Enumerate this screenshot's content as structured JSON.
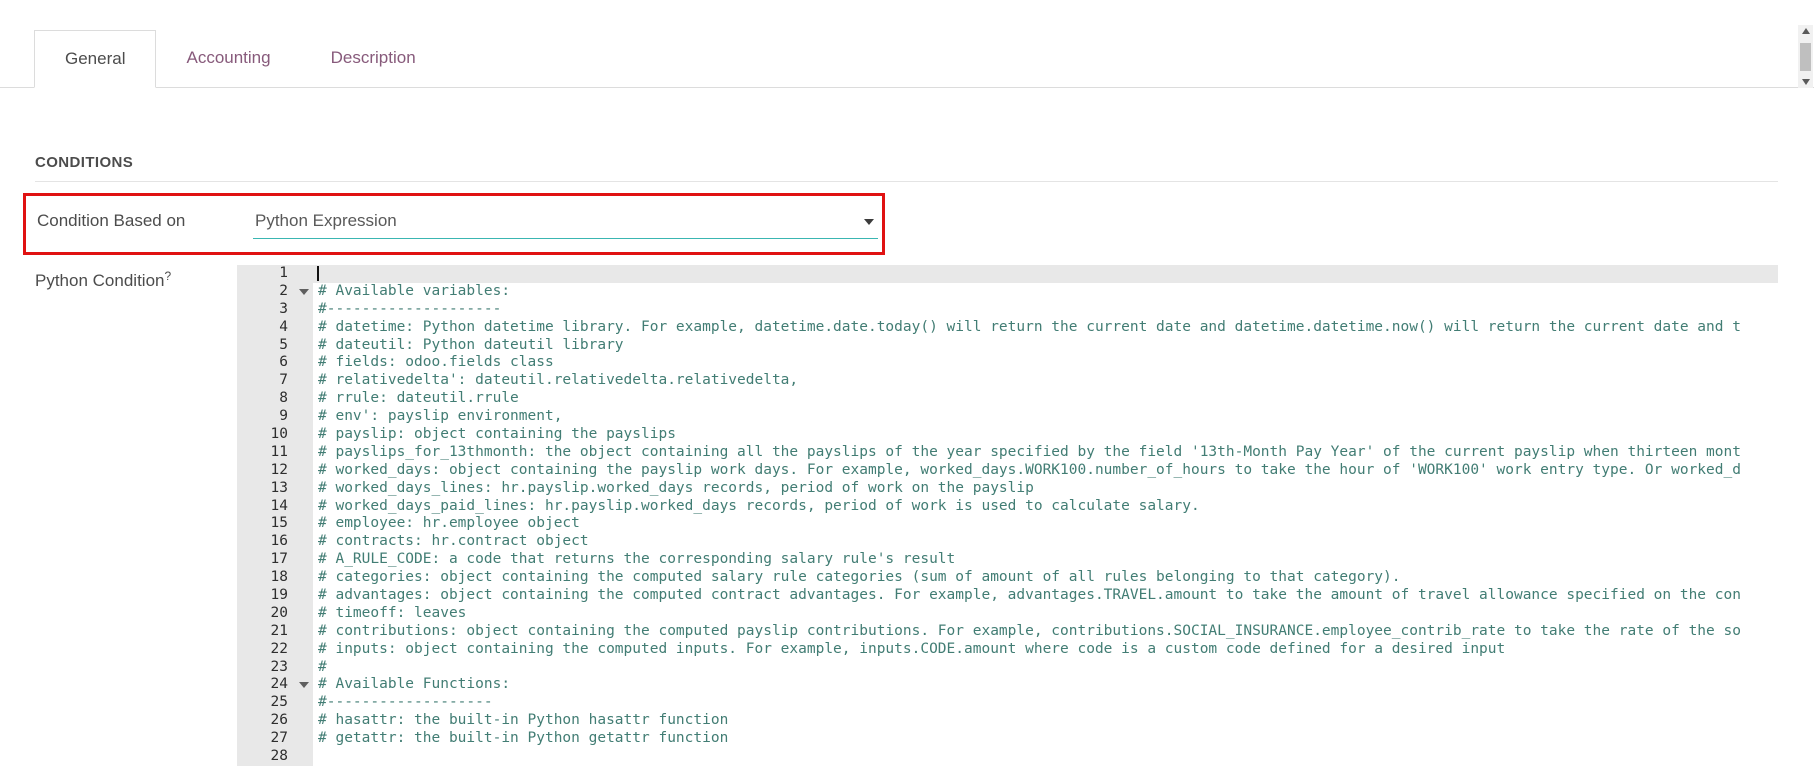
{
  "tabs": [
    {
      "label": "General",
      "active": true
    },
    {
      "label": "Accounting",
      "active": false
    },
    {
      "label": "Description",
      "active": false
    }
  ],
  "conditions_section": {
    "heading": "CONDITIONS"
  },
  "fields": {
    "condition_based_on": {
      "label": "Condition Based on",
      "value": "Python Expression"
    },
    "python_condition": {
      "label": "Python Condition",
      "help_marker": "?"
    }
  },
  "code_editor": {
    "active_line": 1,
    "fold_lines": [
      2,
      24
    ],
    "lines": [
      "",
      "# Available variables:",
      "#--------------------",
      "# datetime: Python datetime library. For example, datetime.date.today() will return the current date and datetime.datetime.now() will return the current date and t",
      "# dateutil: Python dateutil library",
      "# fields: odoo.fields class",
      "# relativedelta': dateutil.relativedelta.relativedelta,",
      "# rrule: dateutil.rrule",
      "# env': payslip environment,",
      "# payslip: object containing the payslips",
      "# payslips_for_13thmonth: the object containing all the payslips of the year specified by the field '13th-Month Pay Year' of the current payslip when thirteen mont",
      "# worked_days: object containing the payslip work days. For example, worked_days.WORK100.number_of_hours to take the hour of 'WORK100' work entry type. Or worked_d",
      "# worked_days_lines: hr.payslip.worked_days records, period of work on the payslip",
      "# worked_days_paid_lines: hr.payslip.worked_days records, period of work is used to calculate salary.",
      "# employee: hr.employee object",
      "# contracts: hr.contract object",
      "# A_RULE_CODE: a code that returns the corresponding salary rule's result",
      "# categories: object containing the computed salary rule categories (sum of amount of all rules belonging to that category).",
      "# advantages: object containing the computed contract advantages. For example, advantages.TRAVEL.amount to take the amount of travel allowance specified on the con",
      "# timeoff: leaves",
      "# contributions: object containing the computed payslip contributions. For example, contributions.SOCIAL_INSURANCE.employee_contrib_rate to take the rate of the so",
      "# inputs: object containing the computed inputs. For example, inputs.CODE.amount where code is a custom code defined for a desired input",
      "#",
      "# Available Functions:",
      "#-------------------",
      "# hasattr: the built-in Python hasattr function",
      "# getattr: the built-in Python getattr function",
      ""
    ]
  },
  "scrollbar": {
    "up_icon": "triangle-up",
    "down_icon": "triangle-down"
  },
  "colors": {
    "accent_purple": "#875A7B",
    "underline_teal": "#3ab6b2",
    "highlight_red": "#e01212",
    "code_text": "#427d74",
    "gutter_bg": "#e8e8e8",
    "active_line_bg": "#e8e8e8"
  }
}
